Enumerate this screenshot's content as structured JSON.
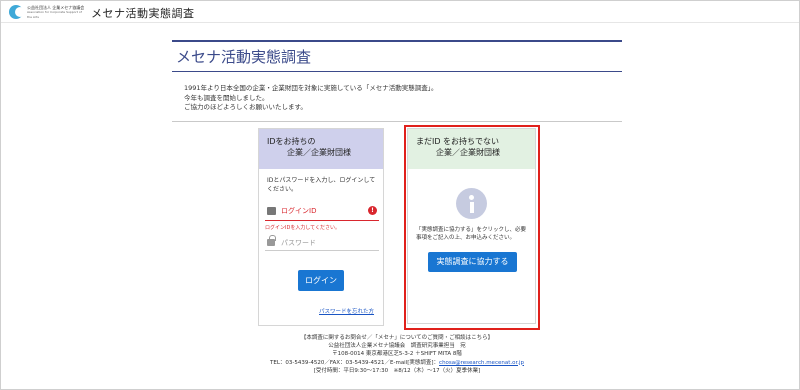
{
  "header": {
    "org_name": "公益社団法人 企業メセナ協議会",
    "org_name_en": "Association for Corporate Support of the Arts",
    "app_title": "メセナ活動実態調査"
  },
  "page": {
    "title": "メセナ活動実態調査",
    "intro": [
      "1991年より日本全国の企業・企業財団を対象に実施している「メセナ活動実態調査」。",
      "今年も調査を開始しました。",
      "ご協力のほどよろしくお願いいたします。"
    ]
  },
  "login_card": {
    "heading_line1": "IDをお持ちの",
    "heading_line2": "企業／企業財団様",
    "description": "IDとパスワードを入力し、ログインしてください。",
    "id_label": "ログインID",
    "id_error": "ログインIDを入力してください。",
    "password_label": "パスワード",
    "login_button": "ログイン",
    "forgot_link": "パスワードを忘れた方"
  },
  "coop_card": {
    "heading_line1": "まだID をお持ちでない",
    "heading_line2": "企業／企業財団様",
    "description": "「実態調査に協力する」をクリックし、必要事項をご記入の上、お申込みください。",
    "coop_button": "実態調査に協力する"
  },
  "footer": {
    "line1": "【本調査に関するお問合せ／「メセナ」についてのご質問・ご相談はこちら】",
    "line2": "公益社団法人企業メセナ協議会　調査研究事業担当　宛",
    "line3": "〒108-0014 東京都港区芝5-3-2 ＋SHIFT MITA 8階",
    "line4_prefix": "TEL：03-5439-4520／FAX：03-5439-4521／E-mail[実態調査]：",
    "email": "chosa@research.mecenat.or.jp",
    "line5": "[受付時間：平日9:30〜17:30　※8/12（木）〜17（火）夏季休業]"
  },
  "colors": {
    "accent": "#3b4a8a",
    "button": "#1976d2",
    "error": "#d9272e",
    "highlight_outline": "#e0201b"
  },
  "icons": {
    "logo": "logo-mark",
    "id_field": "id-card-icon",
    "password_field": "lock-icon",
    "error": "alert-icon",
    "info": "info-icon"
  }
}
